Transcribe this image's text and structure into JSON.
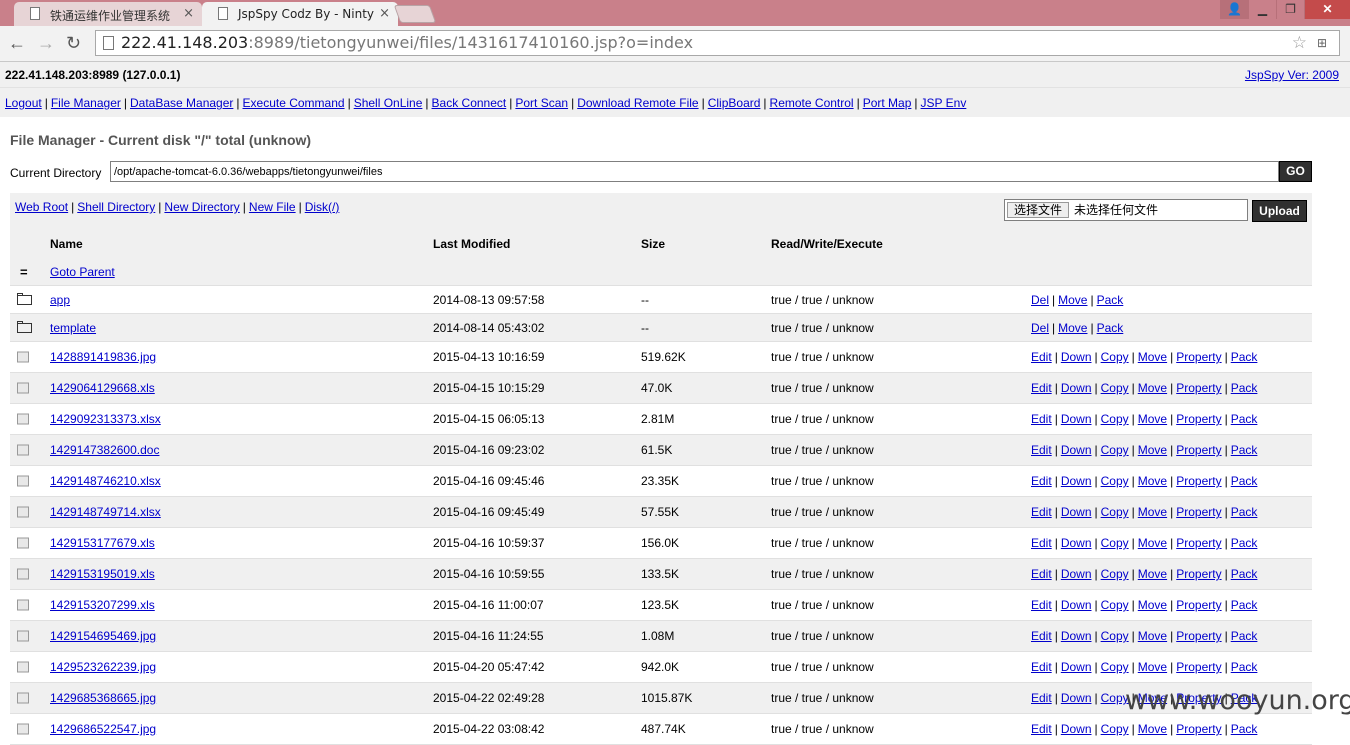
{
  "browser": {
    "tabs": [
      {
        "label": "铁通运维作业管理系统",
        "active": false
      },
      {
        "label": "JspSpy Codz By - Ninty",
        "active": true
      }
    ],
    "close_glyph": "×",
    "window_buttons": {
      "user": "👤",
      "minimize": "▁",
      "maximize": "❐",
      "close": "✕"
    },
    "nav": {
      "back": "←",
      "forward": "→",
      "reload": "↻"
    },
    "url_host": "222.41.148.203",
    "url_rest": ":8989/tietongyunwei/files/1431617410160.jsp?o=index"
  },
  "header": {
    "host": "222.41.148.203:8989 (127.0.0.1)",
    "version": "JspSpy Ver: 2009"
  },
  "menu": [
    "Logout",
    "File Manager",
    "DataBase Manager",
    "Execute Command",
    "Shell OnLine",
    "Back Connect",
    "Port Scan",
    "Download Remote File",
    "ClipBoard",
    "Remote Control",
    "Port Map",
    "JSP Env"
  ],
  "file_manager": {
    "title": "File Manager - Current disk \"/\" total (unknow)",
    "dir_label": "Current Directory",
    "dir_value": "/opt/apache-tomcat-6.0.36/webapps/tietongyunwei/files",
    "go_label": "GO",
    "links": [
      "Web Root",
      "Shell Directory",
      "New Directory",
      "New File",
      "Disk(/)"
    ],
    "choose_file": "选择文件",
    "no_file": "未选择任何文件",
    "upload_label": "Upload"
  },
  "table": {
    "headers": {
      "name": "Name",
      "modified": "Last Modified",
      "size": "Size",
      "rwx": "Read/Write/Execute"
    },
    "parent_icon": "=",
    "parent_label": "Goto Parent",
    "dir_actions": [
      "Del",
      "Move",
      "Pack"
    ],
    "file_actions": [
      "Edit",
      "Down",
      "Copy",
      "Move",
      "Property",
      "Pack"
    ],
    "dirs": [
      {
        "name": "app",
        "modified": "2014-08-13 09:57:58",
        "size": "--",
        "rwx": "true / true / unknow"
      },
      {
        "name": "template",
        "modified": "2014-08-14 05:43:02",
        "size": "--",
        "rwx": "true / true / unknow"
      }
    ],
    "files": [
      {
        "name": "1428891419836.jpg",
        "modified": "2015-04-13 10:16:59",
        "size": "519.62K",
        "rwx": "true / true / unknow"
      },
      {
        "name": "1429064129668.xls",
        "modified": "2015-04-15 10:15:29",
        "size": "47.0K",
        "rwx": "true / true / unknow"
      },
      {
        "name": "1429092313373.xlsx",
        "modified": "2015-04-15 06:05:13",
        "size": "2.81M",
        "rwx": "true / true / unknow"
      },
      {
        "name": "1429147382600.doc",
        "modified": "2015-04-16 09:23:02",
        "size": "61.5K",
        "rwx": "true / true / unknow"
      },
      {
        "name": "1429148746210.xlsx",
        "modified": "2015-04-16 09:45:46",
        "size": "23.35K",
        "rwx": "true / true / unknow"
      },
      {
        "name": "1429148749714.xlsx",
        "modified": "2015-04-16 09:45:49",
        "size": "57.55K",
        "rwx": "true / true / unknow"
      },
      {
        "name": "1429153177679.xls",
        "modified": "2015-04-16 10:59:37",
        "size": "156.0K",
        "rwx": "true / true / unknow"
      },
      {
        "name": "1429153195019.xls",
        "modified": "2015-04-16 10:59:55",
        "size": "133.5K",
        "rwx": "true / true / unknow"
      },
      {
        "name": "1429153207299.xls",
        "modified": "2015-04-16 11:00:07",
        "size": "123.5K",
        "rwx": "true / true / unknow"
      },
      {
        "name": "1429154695469.jpg",
        "modified": "2015-04-16 11:24:55",
        "size": "1.08M",
        "rwx": "true / true / unknow"
      },
      {
        "name": "1429523262239.jpg",
        "modified": "2015-04-20 05:47:42",
        "size": "942.0K",
        "rwx": "true / true / unknow"
      },
      {
        "name": "1429685368665.jpg",
        "modified": "2015-04-22 02:49:28",
        "size": "1015.87K",
        "rwx": "true / true / unknow"
      },
      {
        "name": "1429686522547.jpg",
        "modified": "2015-04-22 03:08:42",
        "size": "487.74K",
        "rwx": "true / true / unknow"
      }
    ]
  },
  "watermark": "www.wooyun.org"
}
